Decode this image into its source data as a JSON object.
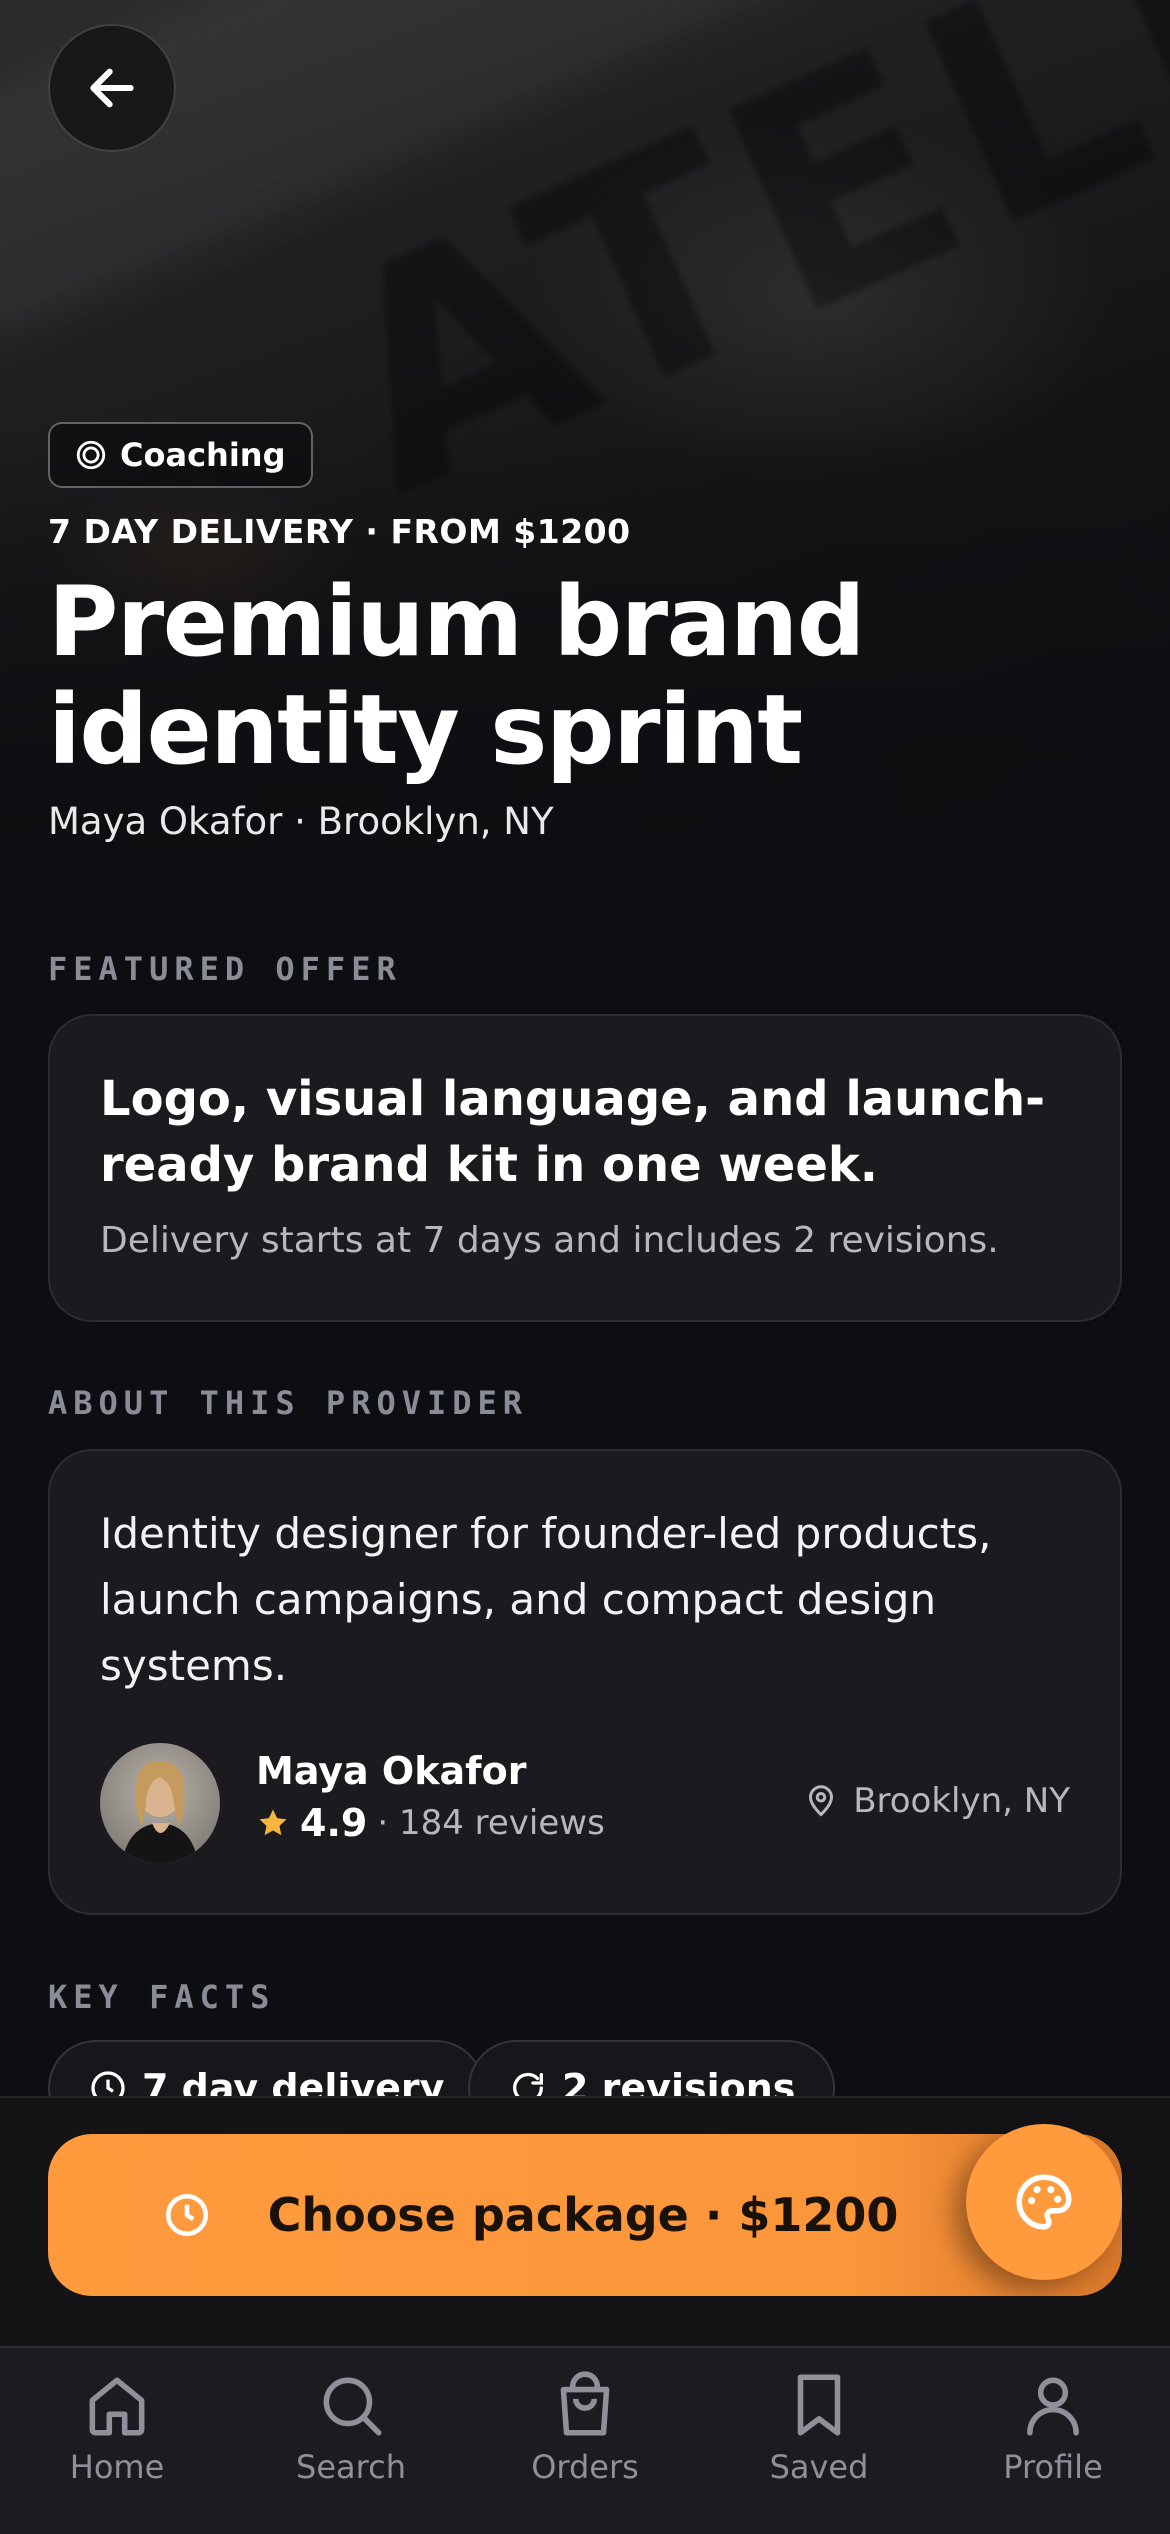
{
  "hero": {
    "category": "Coaching",
    "eyebrow": "7 DAY DELIVERY · FROM $1200",
    "title": "Premium brand identity sprint",
    "byline": "Maya Okafor · Brooklyn, NY"
  },
  "featured_offer": {
    "label": "FEATURED OFFER",
    "headline": "Logo, visual language, and launch-ready brand kit in one week.",
    "subtext": "Delivery starts at 7 days and includes 2 revisions."
  },
  "about": {
    "label": "ABOUT THIS PROVIDER",
    "description": "Identity designer for founder-led products, launch campaigns, and compact design systems.",
    "provider_name": "Maya Okafor",
    "rating": "4.9",
    "reviews": "· 184 reviews",
    "location": "Brooklyn, NY"
  },
  "key_facts": {
    "label": "KEY FACTS",
    "items": [
      {
        "label": "7 day delivery",
        "icon": "clock-icon"
      },
      {
        "label": "2 revisions",
        "icon": "refresh-icon"
      }
    ]
  },
  "cta": {
    "label": "Choose package · $1200",
    "fab_icon": "palette-icon"
  },
  "tabs": [
    {
      "label": "Home",
      "icon": "home-icon"
    },
    {
      "label": "Search",
      "icon": "search-icon"
    },
    {
      "label": "Orders",
      "icon": "bag-icon"
    },
    {
      "label": "Saved",
      "icon": "bookmark-icon"
    },
    {
      "label": "Profile",
      "icon": "person-icon"
    }
  ],
  "colors": {
    "background": "#0d0e11",
    "card": "#1a1a1f",
    "accent": "#ff9a3d",
    "star": "#f6b53d",
    "muted": "#8f9099"
  }
}
